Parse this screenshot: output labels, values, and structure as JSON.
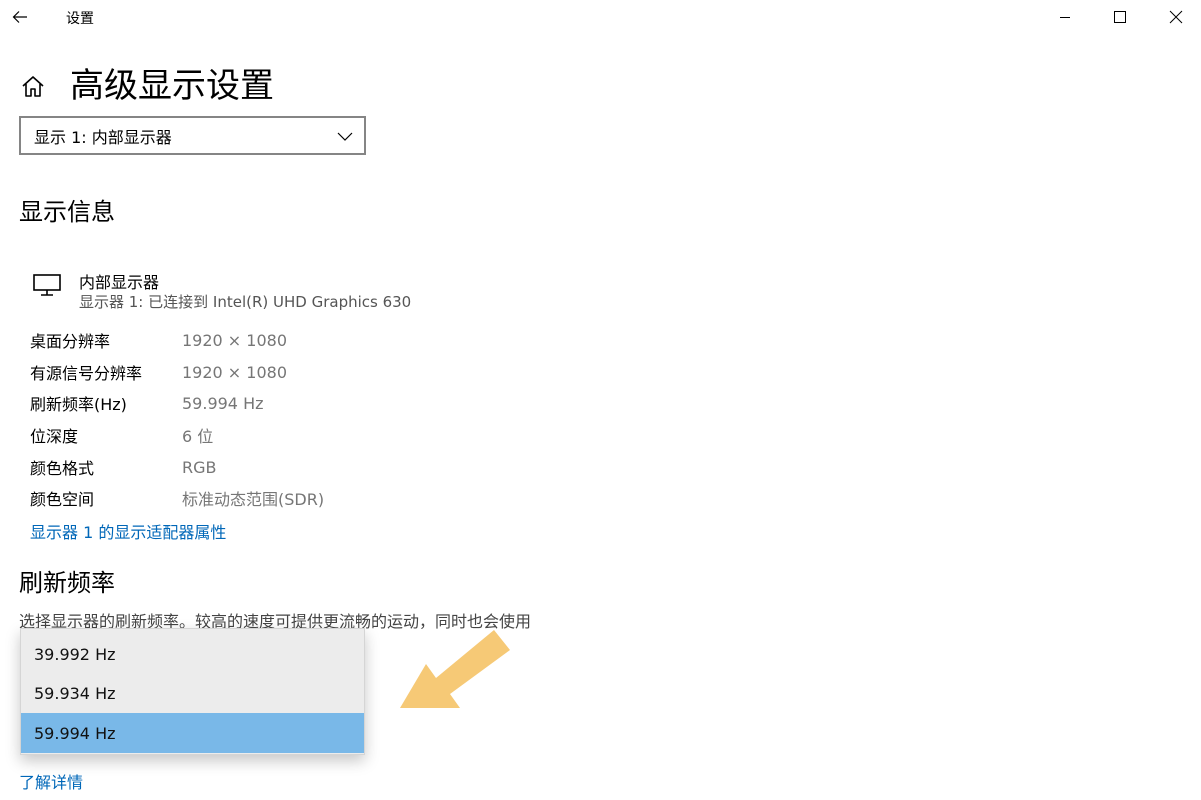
{
  "window": {
    "title": "设置"
  },
  "page": {
    "title": "高级显示设置"
  },
  "display_select": {
    "value": "显示 1: 内部显示器"
  },
  "display_info": {
    "heading": "显示信息",
    "monitor_name": "内部显示器",
    "monitor_sub": "显示器 1: 已连接到 Intel(R) UHD Graphics 630",
    "rows": [
      {
        "label": "桌面分辨率",
        "value": "1920 × 1080"
      },
      {
        "label": "有源信号分辨率",
        "value": "1920 × 1080"
      },
      {
        "label": "刷新频率(Hz)",
        "value": "59.994 Hz"
      },
      {
        "label": "位深度",
        "value": "6 位"
      },
      {
        "label": "颜色格式",
        "value": "RGB"
      },
      {
        "label": "颜色空间",
        "value": "标准动态范围(SDR)"
      }
    ],
    "adapter_link": "显示器 1 的显示适配器属性"
  },
  "refresh": {
    "heading": "刷新频率",
    "description": "选择显示器的刷新频率。较高的速度可提供更流畅的运动，同时也会使用",
    "options": [
      "39.992 Hz",
      "59.934 Hz",
      "59.994 Hz"
    ],
    "selected_index": 2,
    "learn_more": "了解详情"
  },
  "colors": {
    "accent": "#0067b8",
    "selected_item": "#79b8e8",
    "annotation_arrow": "#f5c46a"
  },
  "icons": [
    "back-arrow-icon",
    "minimize-icon",
    "maximize-icon",
    "close-icon",
    "home-icon",
    "chevron-down-icon",
    "monitor-icon"
  ]
}
